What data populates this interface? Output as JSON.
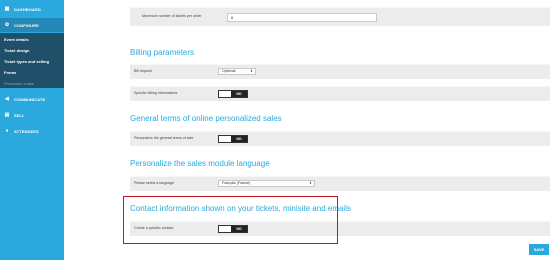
{
  "sidebar": {
    "items": [
      {
        "label": "DASHBOARD",
        "icon": "grid-icon"
      },
      {
        "label": "CONFIGURE",
        "icon": "gear-icon"
      },
      {
        "label": "COMMUNICATE",
        "icon": "megaphone-icon"
      },
      {
        "label": "SELL",
        "icon": "cash-register-icon"
      },
      {
        "label": "ATTENDEES",
        "icon": "person-icon"
      }
    ],
    "sub_items": [
      {
        "label": "Event details"
      },
      {
        "label": "Ticket design"
      },
      {
        "label": "Ticket types and selling"
      },
      {
        "label": "Forms"
      },
      {
        "label": "Promotion codes"
      }
    ]
  },
  "main": {
    "top_row": {
      "label": "Maximum number of tickets per order",
      "value": "6"
    },
    "billing": {
      "title": "Billing parameters",
      "bill_request_label": "Bill request",
      "bill_request_value": "Optional",
      "specific_billing_label": "Specific billing informations",
      "specific_billing_toggle": "NO"
    },
    "terms": {
      "title": "General terms of online personalized sales",
      "label": "Personalize the general terms of sale",
      "toggle": "NO"
    },
    "language": {
      "title": "Personalize the sales module language",
      "label": "Please select a language",
      "value": "Français (France)"
    },
    "contact": {
      "title": "Contact information shown on your tickets, minisite and emails",
      "label": "Create a specific contact",
      "toggle": "NO"
    },
    "save_label": "SAVE"
  },
  "colors": {
    "accent": "#2aa9de",
    "sidebar_dark": "#1f4f69",
    "highlight": "#c4161c"
  }
}
